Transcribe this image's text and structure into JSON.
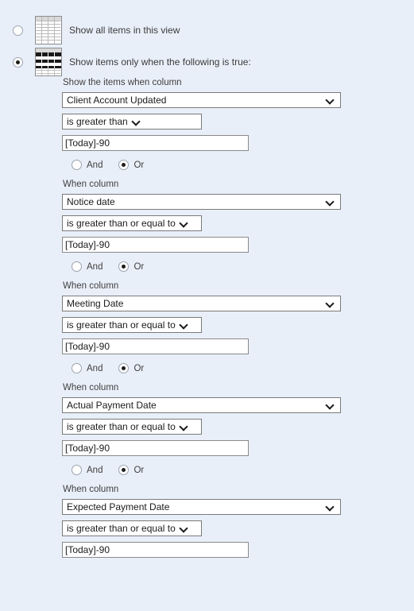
{
  "view_modes": [
    {
      "label": "Show all items in this view",
      "selected": false,
      "icon": "table-grid-icon"
    },
    {
      "label": "Show items only when the following is true:",
      "selected": true,
      "icon": "table-filter-icon"
    }
  ],
  "first_group_label": "Show the items when column",
  "subsequent_group_label": "When column",
  "conjunction": {
    "and_label": "And",
    "or_label": "Or"
  },
  "filters": [
    {
      "column": "Client Account Updated",
      "operator": "is greater than",
      "value": "[Today]-90",
      "conjunction_selected": "Or"
    },
    {
      "column": "Notice date",
      "operator": "is greater than or equal to",
      "value": "[Today]-90",
      "conjunction_selected": "Or"
    },
    {
      "column": "Meeting Date",
      "operator": "is greater than or equal to",
      "value": "[Today]-90",
      "conjunction_selected": "Or"
    },
    {
      "column": "Actual Payment Date",
      "operator": "is greater than or equal to",
      "value": "[Today]-90",
      "conjunction_selected": "Or"
    },
    {
      "column": "Expected Payment Date",
      "operator": "is greater than or equal to",
      "value": "[Today]-90",
      "conjunction_selected": null
    }
  ],
  "colors": {
    "page_background": "#e9eff9",
    "field_background": "#ffffff",
    "field_border": "#7a7a7a",
    "text": "#3f3f3f"
  }
}
